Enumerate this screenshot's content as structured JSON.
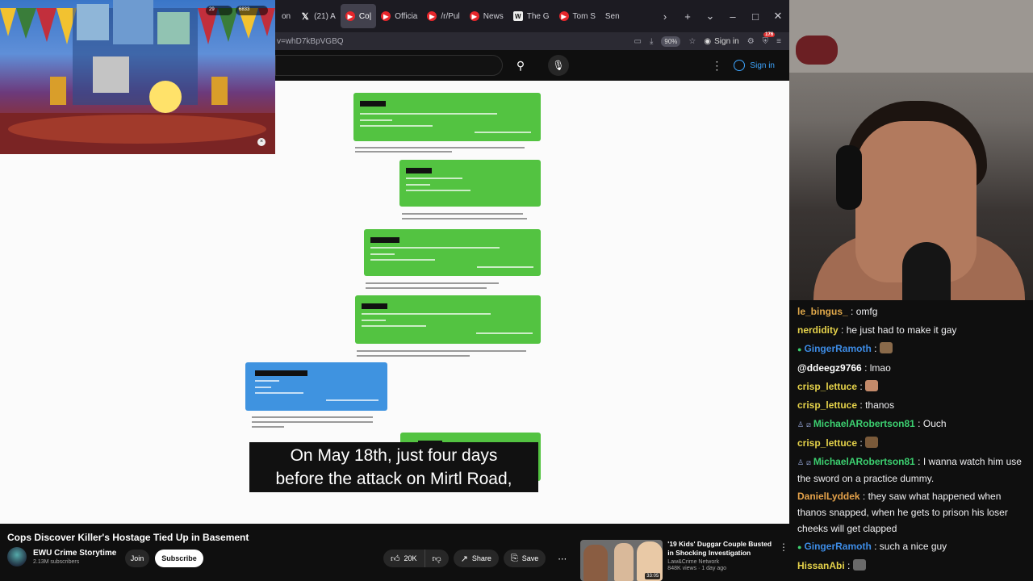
{
  "browser": {
    "tabs": [
      {
        "label": "on",
        "icon": "none"
      },
      {
        "label": "(21) A",
        "icon": "x"
      },
      {
        "label": "Co|",
        "icon": "red",
        "active": true
      },
      {
        "label": "Officia",
        "icon": "red"
      },
      {
        "label": "/r/Pul",
        "icon": "red"
      },
      {
        "label": "News",
        "icon": "red"
      },
      {
        "label": "The G",
        "icon": "white-W"
      },
      {
        "label": "Tom S",
        "icon": "red"
      },
      {
        "label": "Sen",
        "icon": "none"
      }
    ],
    "url": "v=whD7kBpVGBQ",
    "zoom": "90%",
    "sign_in": "Sign in",
    "ext_badge": "176"
  },
  "youtube": {
    "sign_in": "Sign in",
    "video": {
      "caption_line1": "On May 18th, just four days",
      "caption_line2": "before the attack on Mirtl Road,"
    },
    "title": "Cops Discover Killer's Hostage Tied Up in Basement",
    "channel": {
      "name": "EWU Crime Storytime",
      "subs": "2.13M subscribers"
    },
    "join_label": "Join",
    "subscribe_label": "Subscribe",
    "actions": {
      "likes": "20K",
      "share": "Share",
      "save": "Save"
    },
    "recommended": {
      "title": "'19 Kids' Duggar Couple Busted in Shocking Investigation",
      "channel": "Law&Crime Network",
      "views": "848K views · 1 day ago",
      "duration": "33:05"
    }
  },
  "game": {
    "stat1": "29",
    "stat2": "6833"
  },
  "chat": {
    "messages": [
      {
        "user": "le_bingus_",
        "color": "#e0a84a",
        "text": "omfg",
        "badges": []
      },
      {
        "user": "nerdidity",
        "color": "#e5d24a",
        "text": "he just had to make it gay",
        "badges": []
      },
      {
        "user": "GingerRamoth",
        "color": "#3d8ce6",
        "text": "",
        "emote": "#8a6a4a",
        "badges": [
          "g"
        ]
      },
      {
        "user": "@ddeegz9766",
        "color": "#ffffff",
        "text": "lmao",
        "badges": []
      },
      {
        "user": "crisp_lettuce",
        "color": "#e5d24a",
        "text": "",
        "emote": "#c38a6a",
        "badges": []
      },
      {
        "user": "crisp_lettuce",
        "color": "#e5d24a",
        "text": "thanos",
        "badges": []
      },
      {
        "user": "MichaelARobertson81",
        "color": "#3cd070",
        "text": "Ouch",
        "badges": [
          "p",
          "s"
        ]
      },
      {
        "user": "crisp_lettuce",
        "color": "#e5d24a",
        "text": "",
        "emote": "#7a5a3a",
        "badges": []
      },
      {
        "user": "MichaelARobertson81",
        "color": "#3cd070",
        "text": "I wanna watch him use the sword on a practice dummy.",
        "badges": [
          "p",
          "s"
        ]
      },
      {
        "user": "DanielLyddek",
        "color": "#e5a24a",
        "text": "they saw what happened when thanos snapped, when he gets to prison his loser cheeks will get clapped",
        "badges": []
      },
      {
        "user": "GingerRamoth",
        "color": "#3d8ce6",
        "text": "such a nice guy",
        "badges": [
          "g"
        ]
      },
      {
        "user": "HissanAbi",
        "color": "#e5d24a",
        "text": "",
        "emote": "#6a6a6a",
        "badges": []
      }
    ]
  }
}
